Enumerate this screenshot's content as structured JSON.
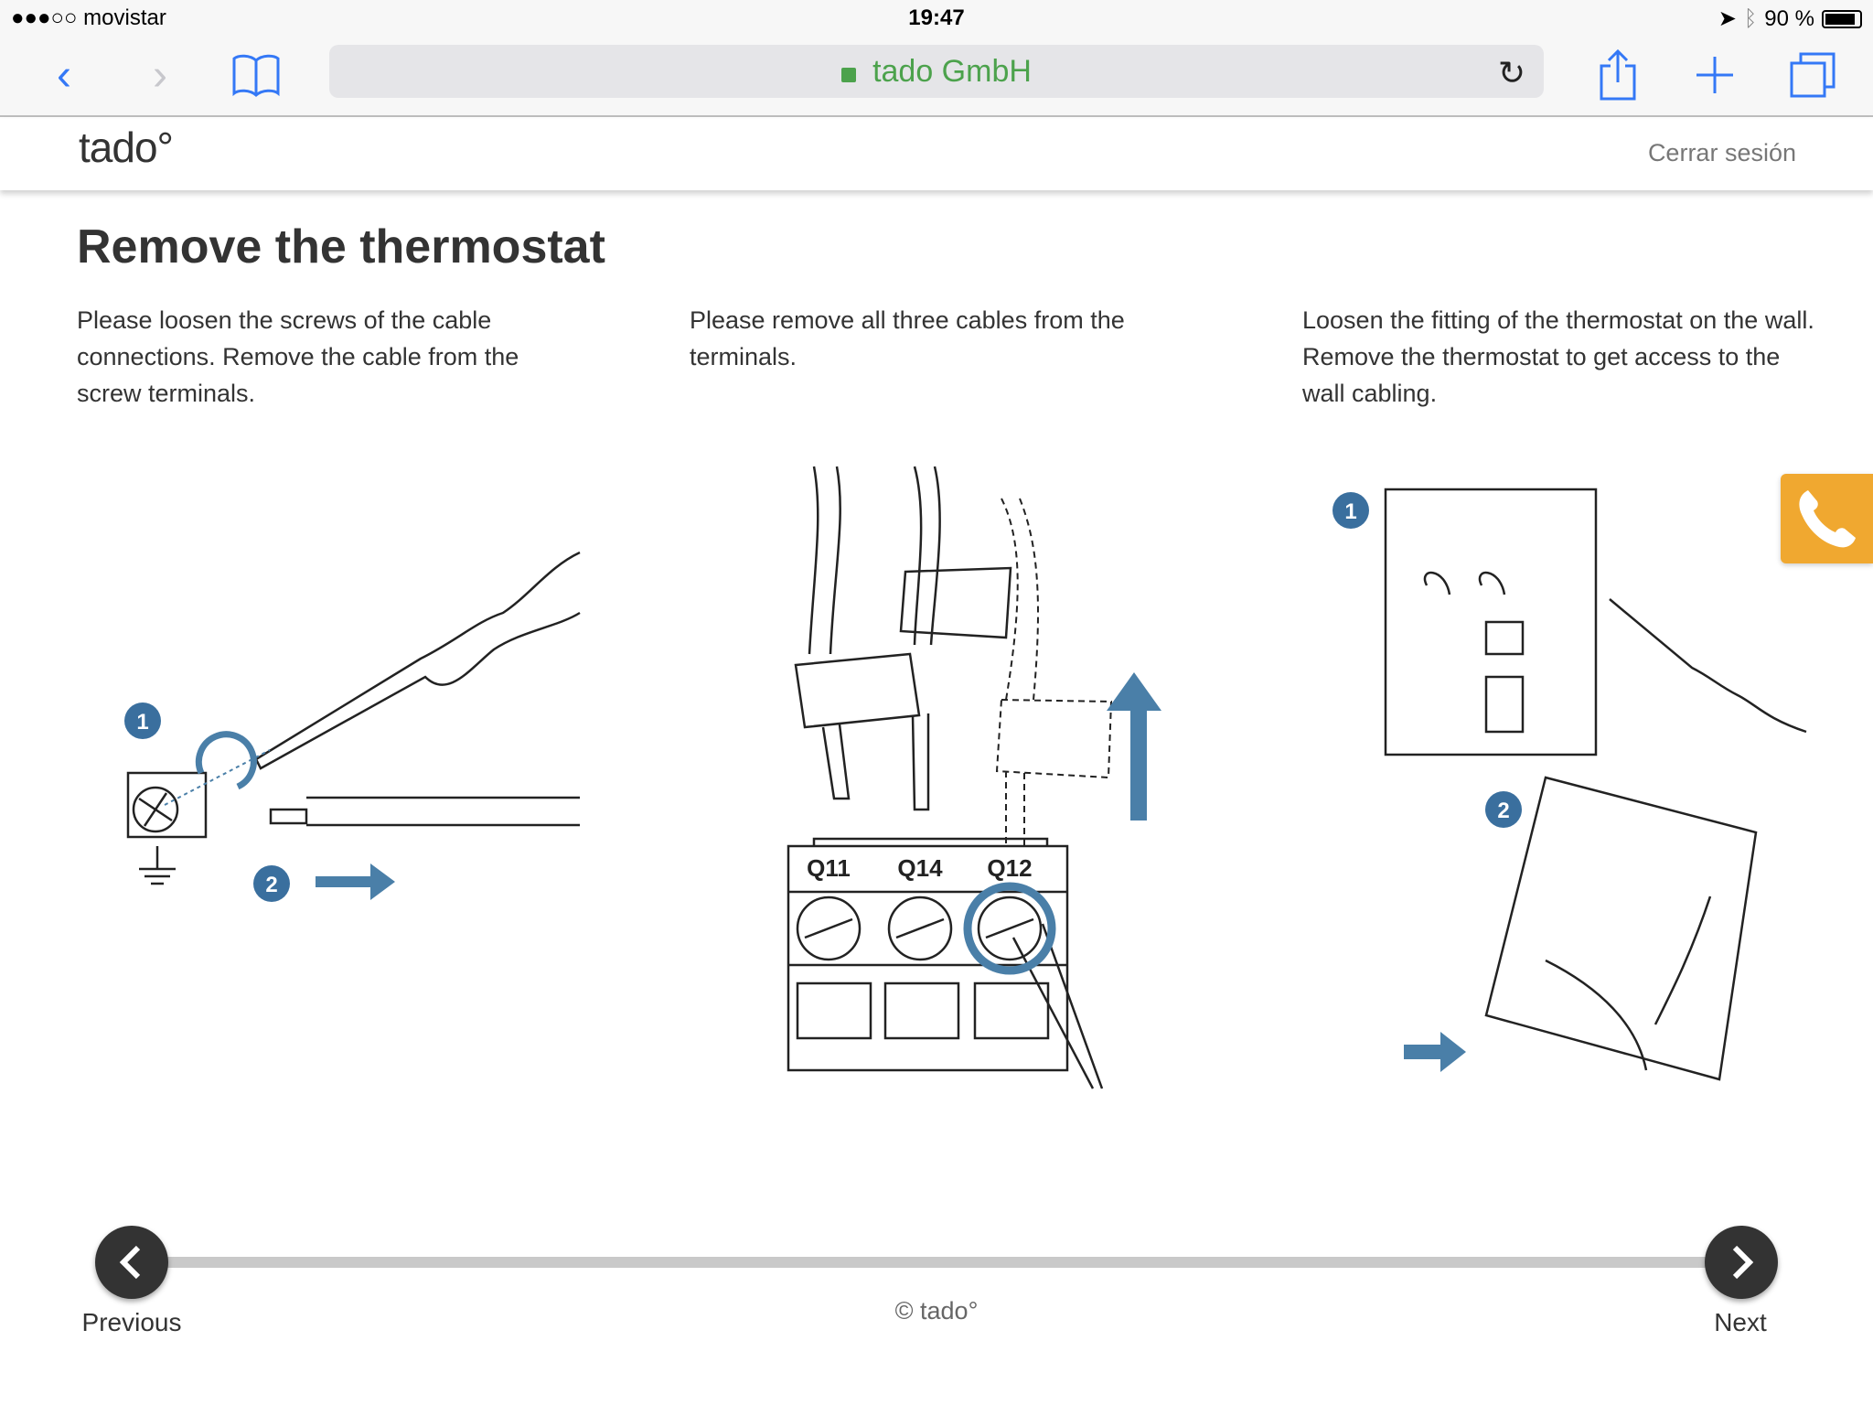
{
  "status_bar": {
    "carrier": "●●●○○ movistar",
    "time": "19:47",
    "battery": "90 %",
    "battery_level": 0.9
  },
  "browser": {
    "url_title": "tado GmbH",
    "secure": true,
    "accent": "#3478f6"
  },
  "header": {
    "logo": "tado°",
    "logout": "Cerrar sesión"
  },
  "page": {
    "title": "Remove the thermostat",
    "steps": [
      {
        "text": "Please loosen the screws of the cable connections. Remove the cable from the screw terminals."
      },
      {
        "text": "Please remove all three cables from the terminals.",
        "terminals": [
          "Q11",
          "Q14",
          "Q12"
        ]
      },
      {
        "text": "Loosen the fitting of the thermostat on the wall. Remove the thermostat to get access to the wall cabling."
      }
    ],
    "illustration_color": "#4a7fa8"
  },
  "footer": {
    "previous": "Previous",
    "next": "Next",
    "copyright": "© tado°"
  },
  "call_button_color": "#f0a830"
}
